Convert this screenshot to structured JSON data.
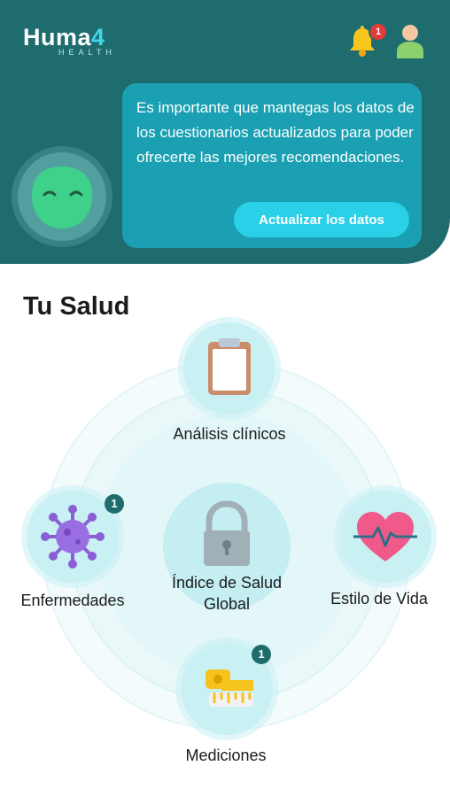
{
  "header": {
    "logo_main": "Huma",
    "logo_accent": "4",
    "logo_sub": "HEALTH",
    "notification_count": "1",
    "message": "Es importante que mantegas los datos de los cuestionarios actualizados para poder ofrecerte las mejores recomendaciones.",
    "update_button": "Actualizar los datos"
  },
  "health": {
    "title": "Tu Salud",
    "center_label": "Índice de Salud Global",
    "nodes": {
      "analisis": {
        "label": "Análisis clínicos"
      },
      "enfermedades": {
        "label": "Enfermedades",
        "badge": "1"
      },
      "estilo": {
        "label": "Estilo de Vida"
      },
      "mediciones": {
        "label": "Mediciones",
        "badge": "1"
      }
    }
  },
  "icons": {
    "bell": "bell-icon",
    "user": "user-icon",
    "clipboard": "clipboard-icon",
    "virus": "virus-icon",
    "heart": "heart-pulse-icon",
    "ruler": "tape-measure-icon",
    "lock": "lock-icon"
  },
  "colors": {
    "header_bg": "#1f6c6f",
    "bubble_bg": "#1aa0b2",
    "button_bg": "#2ad0e8",
    "node_bg": "#c9f1f4",
    "badge_bg": "#1f6c6f",
    "notif_bg": "#e53935"
  }
}
